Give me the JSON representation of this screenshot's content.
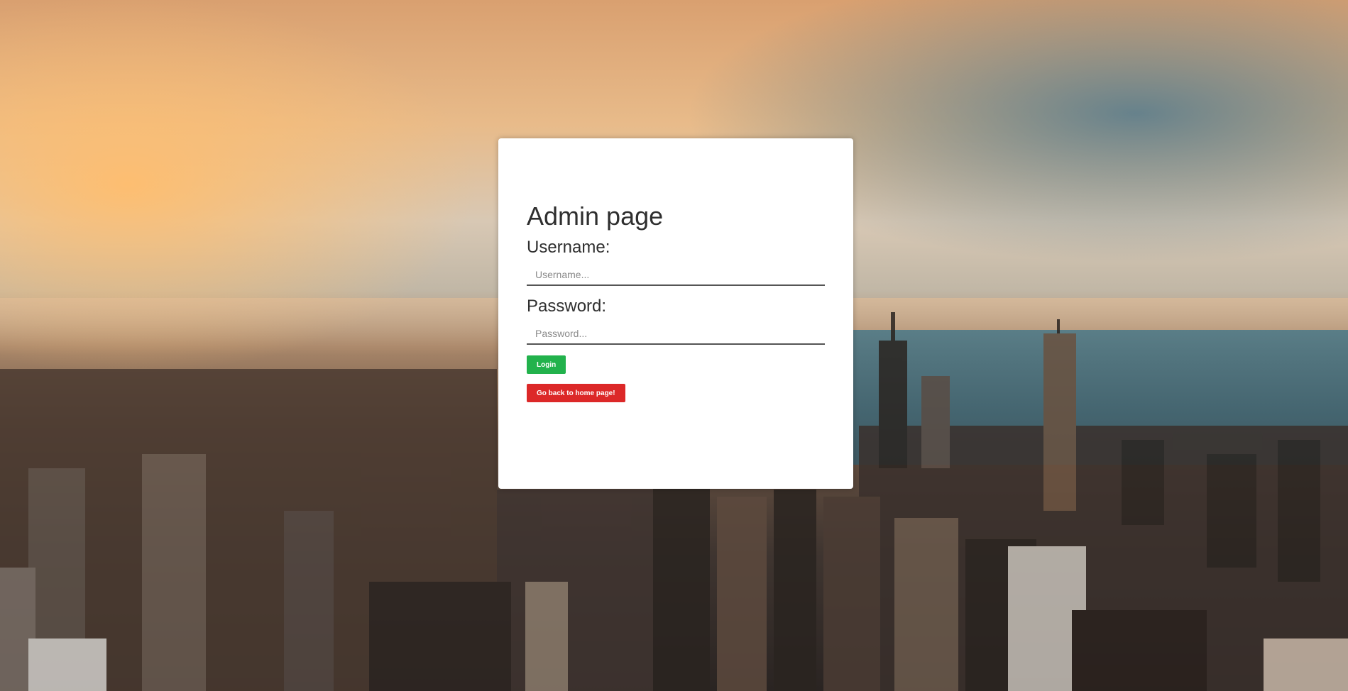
{
  "admin": {
    "title": "Admin page",
    "username_label": "Username:",
    "username_placeholder": "Username...",
    "password_label": "Password:",
    "password_placeholder": "Password...",
    "login_label": "Login",
    "home_label": "Go back to home page!"
  },
  "colors": {
    "login_button": "#22b24c",
    "home_button": "#dc2828"
  }
}
